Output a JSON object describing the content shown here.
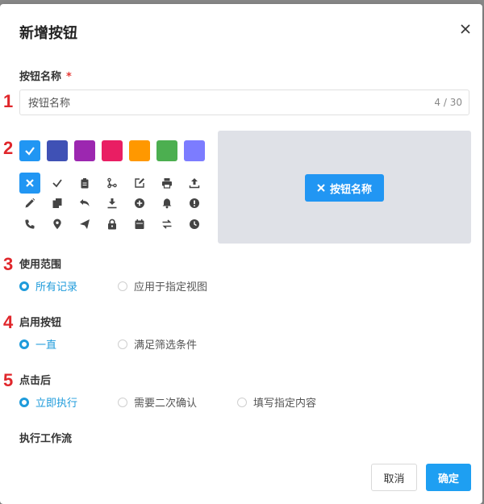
{
  "dialog": {
    "title": "新增按钮",
    "close_icon": "close-icon"
  },
  "markers": [
    "1",
    "2",
    "3",
    "4",
    "5"
  ],
  "name_field": {
    "label": "按钮名称",
    "required": "*",
    "placeholder": "按钮名称",
    "value": "",
    "counter": "4 / 30"
  },
  "colors": {
    "selected_index": 0,
    "swatches": [
      "#2196f3",
      "#3f51b5",
      "#9c27b0",
      "#e91e63",
      "#ff9800",
      "#4caf50",
      "#7c7cff"
    ]
  },
  "icons": {
    "selected_index": 0,
    "items": [
      "close-icon",
      "check-icon",
      "clipboard-icon",
      "branch-icon",
      "edit-icon",
      "print-icon",
      "upload-icon",
      "pencil-icon",
      "copy-icon",
      "undo-icon",
      "download-icon",
      "plus-circle-icon",
      "bell-icon",
      "alert-circle-icon",
      "phone-icon",
      "location-icon",
      "send-icon",
      "lock-icon",
      "calendar-icon",
      "swap-icon",
      "clock-icon"
    ]
  },
  "preview": {
    "button_label": "按钮名称",
    "button_icon": "close-icon"
  },
  "scope": {
    "label": "使用范围",
    "options": [
      "所有记录",
      "应用于指定视图"
    ],
    "selected": 0
  },
  "enable": {
    "label": "启用按钮",
    "options": [
      "一直",
      "满足筛选条件"
    ],
    "selected": 0
  },
  "after_click": {
    "label": "点击后",
    "options": [
      "立即执行",
      "需要二次确认",
      "填写指定内容"
    ],
    "selected": 0
  },
  "workflow": {
    "label": "执行工作流"
  },
  "footer": {
    "cancel_label": "取消",
    "confirm_label": "确定"
  }
}
